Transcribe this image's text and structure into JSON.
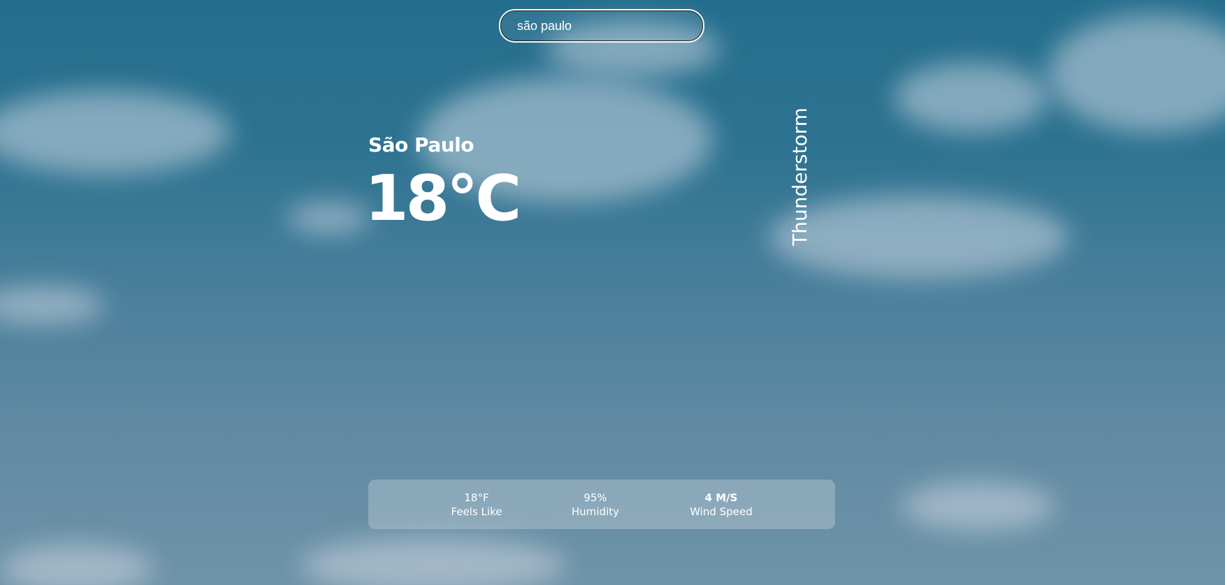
{
  "search": {
    "value": "são paulo"
  },
  "weather": {
    "location": "São Paulo",
    "temperature": "18°C",
    "condition": "Thunderstorm"
  },
  "stats": [
    {
      "value": "18°F",
      "label": "Feels Like"
    },
    {
      "value": "95%",
      "label": "Humidity"
    },
    {
      "value": "4 M/S",
      "label": "Wind Speed"
    }
  ]
}
